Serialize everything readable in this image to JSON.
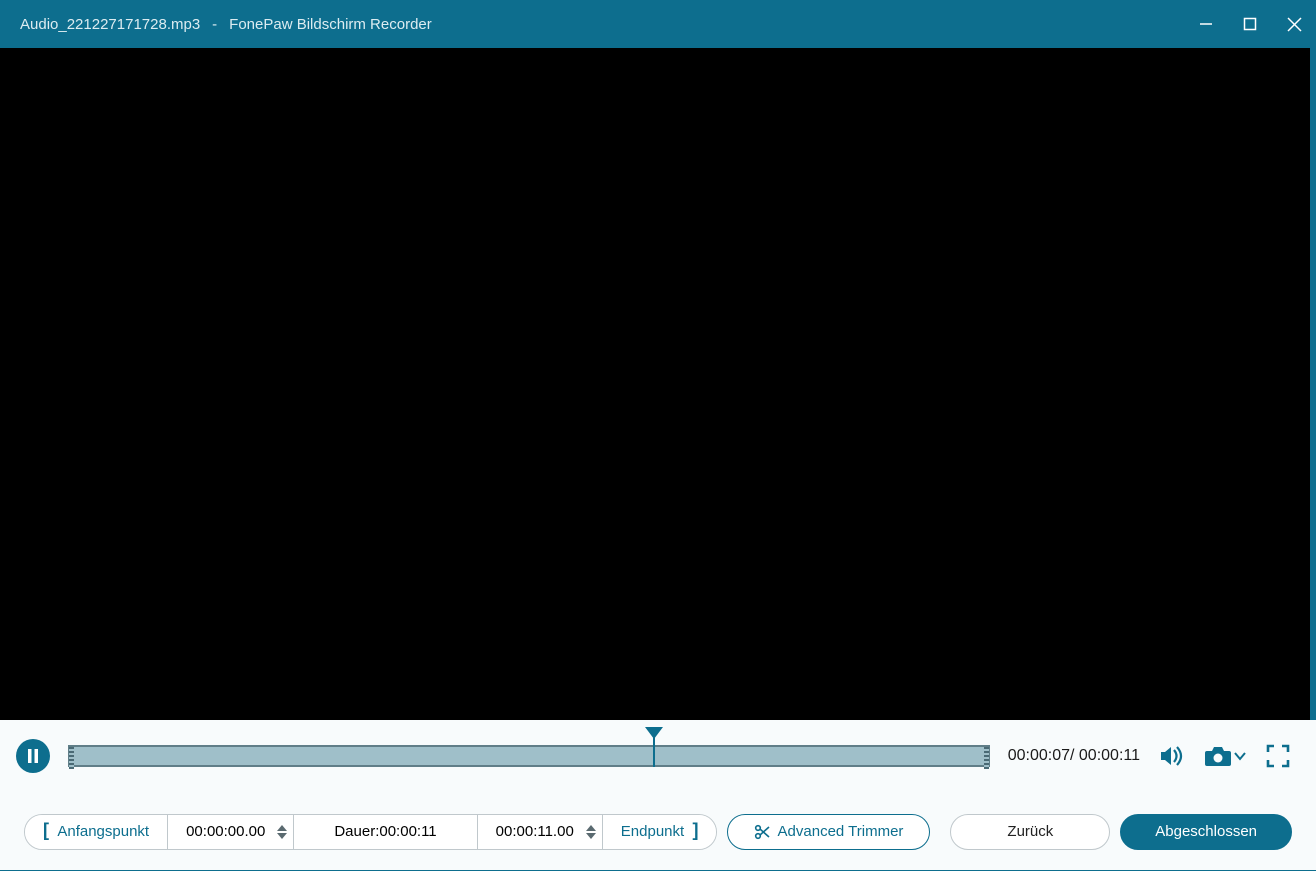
{
  "titlebar": {
    "filename": "Audio_221227171728.mp3",
    "separator": "-",
    "appname": "FonePaw Bildschirm Recorder"
  },
  "playback": {
    "current_time": "00:00:07",
    "total_time": "00:00:11",
    "display": "00:00:07/ 00:00:11",
    "progress_percent": 63.6
  },
  "trim": {
    "start_label": "Anfangspunkt",
    "start_time": "00:00:00.00",
    "duration_prefix": "Dauer:",
    "duration_value": "00:00:11",
    "end_time": "00:00:11.00",
    "end_label": "Endpunkt",
    "advanced_trimmer": "Advanced Trimmer",
    "back_label": "Zurück",
    "done_label": "Abgeschlossen"
  },
  "icons": {
    "pause": "pause",
    "volume": "volume",
    "camera": "camera",
    "fullscreen": "fullscreen",
    "scissors": "scissors"
  },
  "colors": {
    "accent": "#0d6e8e",
    "track": "#9fbfc9",
    "light_bg": "#f8fbfc"
  }
}
